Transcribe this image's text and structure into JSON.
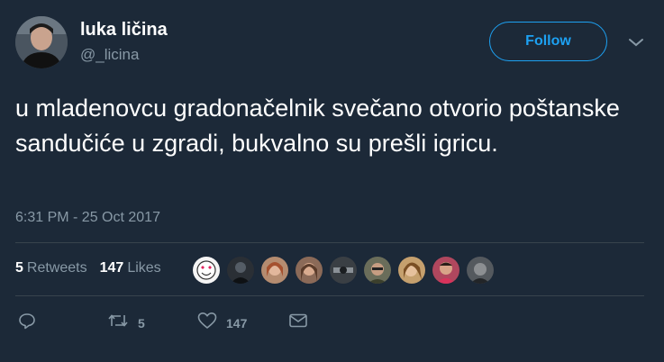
{
  "user": {
    "display_name": "luka ličina",
    "handle": "@_licina"
  },
  "follow_label": "Follow",
  "tweet": {
    "text": "u mladenovcu gradonačelnik svečano otvorio poštanske sandučiće u zgradi, bukvalno su prešli igricu.",
    "timestamp": "6:31 PM - 25 Oct 2017"
  },
  "stats": {
    "retweets_count": "5",
    "retweets_label": "Retweets",
    "likes_count": "147",
    "likes_label": "Likes"
  },
  "actions": {
    "reply_icon": "reply-icon",
    "retweet_icon": "retweet-icon",
    "retweet_count": "5",
    "like_icon": "heart-icon",
    "like_count": "147",
    "message_icon": "envelope-icon"
  },
  "colors": {
    "background": "#1c2938",
    "accent": "#1da1f2",
    "muted_text": "#8899a6",
    "divider": "#38444d"
  }
}
